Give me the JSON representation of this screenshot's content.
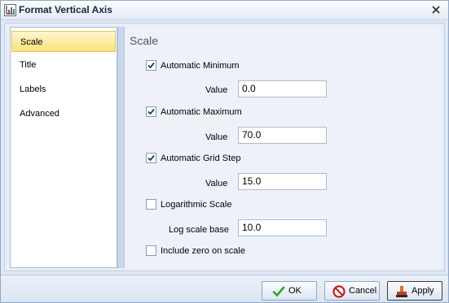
{
  "window": {
    "title": "Format Vertical Axis",
    "close_icon": "close-icon",
    "app_icon": "chart-axis-icon"
  },
  "nav": {
    "items": [
      {
        "label": "Scale",
        "active": true
      },
      {
        "label": "Title",
        "active": false
      },
      {
        "label": "Labels",
        "active": false
      },
      {
        "label": "Advanced",
        "active": false
      }
    ]
  },
  "panel": {
    "title": "Scale",
    "automatic_minimum": {
      "label": "Automatic Minimum",
      "checked": true,
      "value_label": "Value",
      "value": "0.0"
    },
    "automatic_maximum": {
      "label": "Automatic Maximum",
      "checked": true,
      "value_label": "Value",
      "value": "70.0"
    },
    "automatic_grid_step": {
      "label": "Automatic Grid Step",
      "checked": true,
      "value_label": "Value",
      "value": "15.0"
    },
    "logarithmic_scale": {
      "label": "Logarithmic Scale",
      "checked": false,
      "base_label": "Log scale base",
      "base_value": "10.0"
    },
    "include_zero": {
      "label": "Include zero on scale",
      "checked": false
    }
  },
  "buttons": {
    "ok": "OK",
    "cancel": "Cancel",
    "apply": "Apply"
  },
  "colors": {
    "accent": "#fbe27a",
    "ok_check": "#33a41c",
    "cancel_red": "#c91c1c"
  }
}
